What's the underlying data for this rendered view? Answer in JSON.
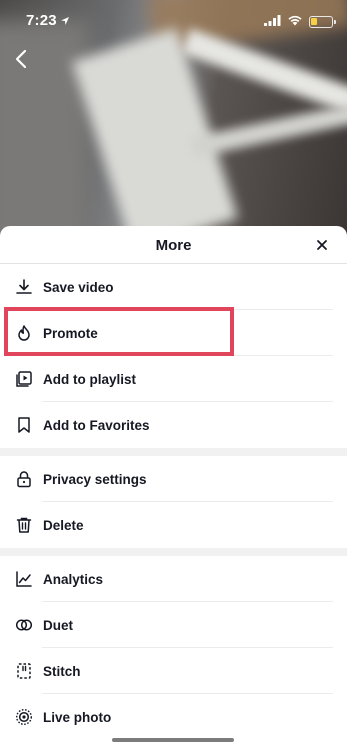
{
  "status_bar": {
    "time": "7:23"
  },
  "sheet": {
    "title": "More",
    "groups": [
      {
        "items": [
          {
            "label": "Save video",
            "icon": "download-icon"
          },
          {
            "label": "Promote",
            "icon": "flame-icon"
          },
          {
            "label": "Add to playlist",
            "icon": "playlist-icon"
          },
          {
            "label": "Add to Favorites",
            "icon": "bookmark-icon"
          }
        ]
      },
      {
        "items": [
          {
            "label": "Privacy settings",
            "icon": "lock-icon"
          },
          {
            "label": "Delete",
            "icon": "trash-icon"
          }
        ]
      },
      {
        "items": [
          {
            "label": "Analytics",
            "icon": "analytics-icon"
          },
          {
            "label": "Duet",
            "icon": "duet-icon"
          },
          {
            "label": "Stitch",
            "icon": "stitch-icon"
          },
          {
            "label": "Live photo",
            "icon": "live-photo-icon"
          }
        ]
      }
    ]
  },
  "colors": {
    "highlight": "#e0455c",
    "text": "#161823",
    "battery": "#f6d148"
  }
}
